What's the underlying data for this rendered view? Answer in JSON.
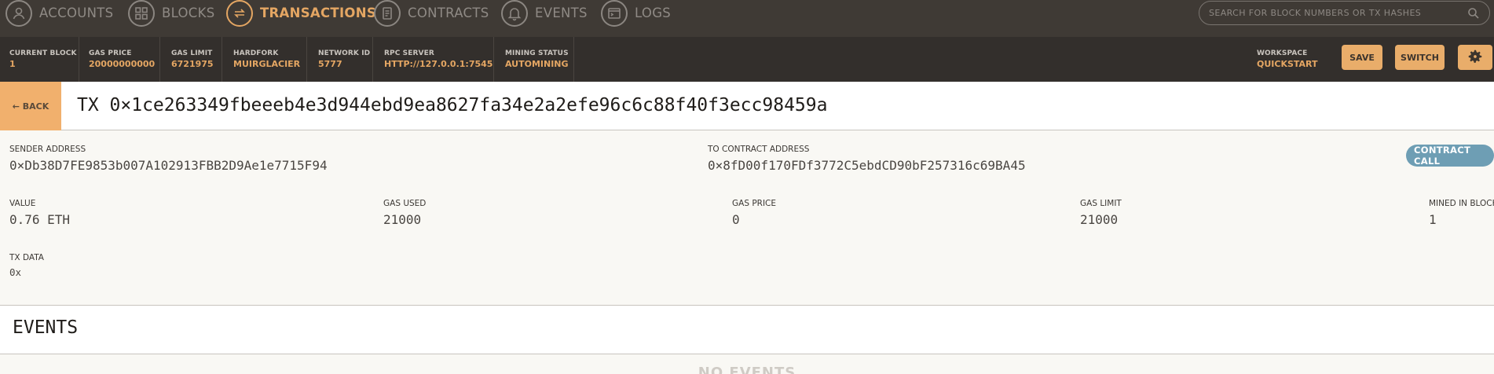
{
  "nav": {
    "items": [
      {
        "label": "ACCOUNTS",
        "icon": "person-icon",
        "active": false
      },
      {
        "label": "BLOCKS",
        "icon": "blocks-grid-icon",
        "active": false
      },
      {
        "label": "TRANSACTIONS",
        "icon": "transfer-arrows-icon",
        "active": true
      },
      {
        "label": "CONTRACTS",
        "icon": "document-icon",
        "active": false
      },
      {
        "label": "EVENTS",
        "icon": "bell-icon",
        "active": false
      },
      {
        "label": "LOGS",
        "icon": "terminal-icon",
        "active": false
      }
    ],
    "search_placeholder": "SEARCH FOR BLOCK NUMBERS OR TX HASHES"
  },
  "status": {
    "current_block": {
      "label": "CURRENT BLOCK",
      "value": "1"
    },
    "gas_price": {
      "label": "GAS PRICE",
      "value": "20000000000"
    },
    "gas_limit": {
      "label": "GAS LIMIT",
      "value": "6721975"
    },
    "hardfork": {
      "label": "HARDFORK",
      "value": "MUIRGLACIER"
    },
    "network_id": {
      "label": "NETWORK ID",
      "value": "5777"
    },
    "rpc_server": {
      "label": "RPC SERVER",
      "value": "HTTP://127.0.0.1:7545"
    },
    "mining_status": {
      "label": "MINING STATUS",
      "value": "AUTOMINING"
    },
    "workspace": {
      "label": "WORKSPACE",
      "value": "QUICKSTART"
    },
    "save_label": "SAVE",
    "switch_label": "SWITCH"
  },
  "tx": {
    "back_label": "← BACK",
    "title": "TX 0×1ce263349fbeeeb4e3d944ebd9ea8627fa34e2a2efe96c6c88f40f3ecc98459a",
    "sender_label": "SENDER ADDRESS",
    "sender_value": "0×Db38D7FE9853b007A102913FBB2D9Ae1e7715F94",
    "to_label": "TO CONTRACT ADDRESS",
    "to_value": "0×8fD00f170FDf3772C5ebdCD90bF257316c69BA45",
    "badge": "CONTRACT CALL",
    "value_label": "VALUE",
    "value_value": "0.76 ETH",
    "gas_used_label": "GAS USED",
    "gas_used_value": "21000",
    "gas_price_label": "GAS PRICE",
    "gas_price_value": "0",
    "gas_limit_label": "GAS LIMIT",
    "gas_limit_value": "21000",
    "mined_label": "MINED IN BLOCK",
    "mined_value": "1",
    "data_label": "TX DATA",
    "data_value": "0x"
  },
  "events": {
    "title": "EVENTS",
    "empty_text": "NO EVENTS"
  },
  "colors": {
    "accent": "#e4a663",
    "nav_bg": "#3f3a35",
    "status_bg": "#332f2c",
    "badge": "#6e9eb4"
  }
}
